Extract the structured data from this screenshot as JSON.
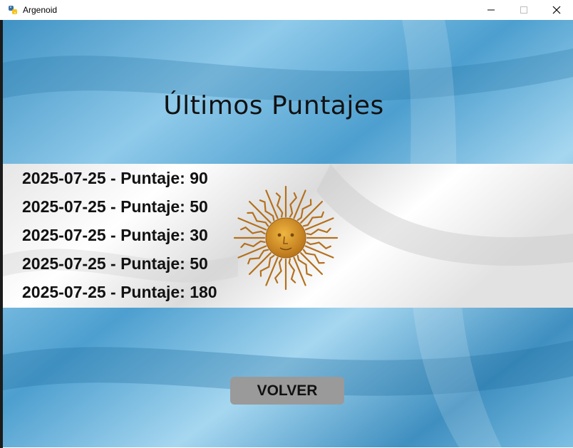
{
  "window": {
    "title": "Argenoid",
    "app_icon": "python-icon",
    "controls": {
      "minimize": "–",
      "maximize": "☐",
      "close": "✕"
    }
  },
  "screen": {
    "heading": "Últimos Puntajes",
    "scores": [
      "2025-07-25 - Puntaje: 90",
      "2025-07-25 - Puntaje: 50",
      "2025-07-25 - Puntaje: 30",
      "2025-07-25 - Puntaje: 50",
      "2025-07-25 - Puntaje: 180"
    ],
    "back_button": "VOLVER"
  },
  "colors": {
    "flag_blue": "#6cb4dc",
    "flag_white": "#f4f4f4",
    "sun": "#c7871f",
    "button": "#9a9a9a"
  }
}
